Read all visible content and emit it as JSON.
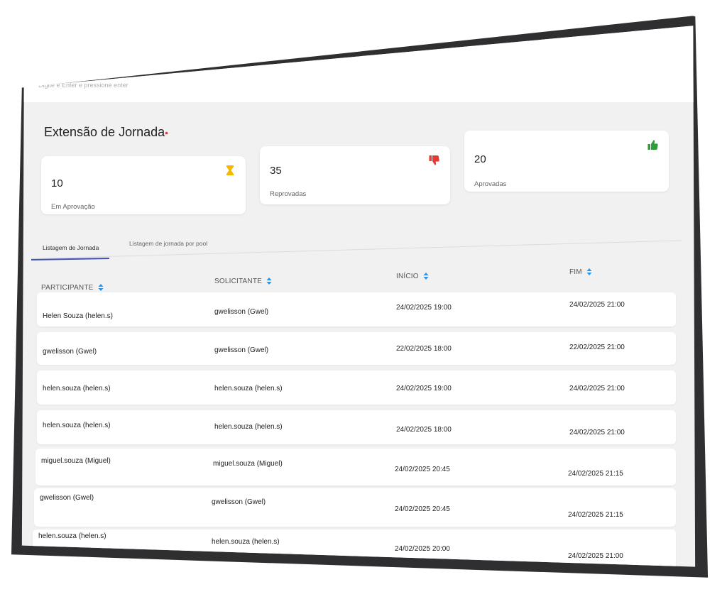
{
  "search": {
    "placeholder": "Digite e Enter e pressione enter"
  },
  "page": {
    "title": "Extensão de Jornada",
    "required_marker": "•"
  },
  "cards": [
    {
      "count": "10",
      "label": "Em Aprovação",
      "icon": "hourglass-icon",
      "color": "#f5b800"
    },
    {
      "count": "35",
      "label": "Reprovadas",
      "icon": "thumbs-down-icon",
      "color": "#e53935"
    },
    {
      "count": "20",
      "label": "Aprovadas",
      "icon": "thumbs-up-icon",
      "color": "#2e9e3a"
    }
  ],
  "tabs": [
    {
      "label": "Listagem de Jornada",
      "active": true
    },
    {
      "label": "Listagem de jornada por pool",
      "active": false
    }
  ],
  "table": {
    "headers": [
      "PARTICIPANTE",
      "SOLICITANTE",
      "INÍCIO",
      "FIM"
    ],
    "sort_icon_color": "#2196f3",
    "rows": [
      [
        "Helen Souza (helen.s)",
        "gwelisson (Gwel)",
        "24/02/2025 19:00",
        "24/02/2025 21:00"
      ],
      [
        "gwelisson (Gwel)",
        "gwelisson (Gwel)",
        "22/02/2025 18:00",
        "22/02/2025 21:00"
      ],
      [
        "helen.souza (helen.s)",
        "helen.souza (helen.s)",
        "24/02/2025 19:00",
        "24/02/2025 21:00"
      ],
      [
        "helen.souza (helen.s)",
        "helen.souza (helen.s)",
        "24/02/2025 18:00",
        "24/02/2025 21:00"
      ],
      [
        "miguel.souza (Miguel)",
        "miguel.souza (Miguel)",
        "24/02/2025 20:45",
        "24/02/2025 21:15"
      ],
      [
        "gwelisson (Gwel)",
        "gwelisson (Gwel)",
        "24/02/2025 20:45",
        "24/02/2025 21:15"
      ],
      [
        "helen.souza (helen.s)",
        "helen.souza (helen.s)",
        "24/02/2025 20:00",
        "24/02/2025 21:00"
      ]
    ]
  }
}
